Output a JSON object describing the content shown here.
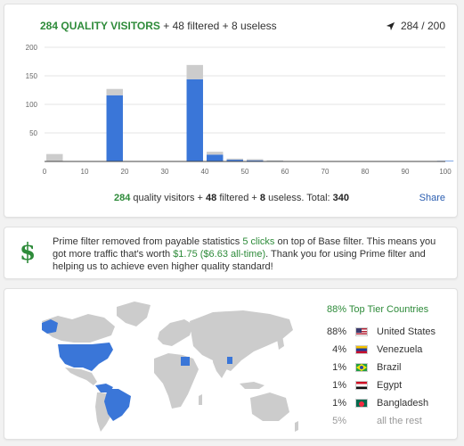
{
  "header": {
    "quality_count": "284 QUALITY VISITORS",
    "rest": " + 48 filtered + 8 useless",
    "counter": "284 / 200",
    "counter_icon": "send-arrow-icon"
  },
  "chart_data": {
    "type": "bar",
    "stacked": true,
    "x": [
      0,
      5,
      10,
      15,
      20,
      25,
      30,
      35,
      40,
      45,
      50,
      55,
      60,
      65,
      70,
      75,
      80,
      85,
      90,
      95,
      100
    ],
    "xticks": [
      0,
      10,
      20,
      30,
      40,
      50,
      60,
      70,
      80,
      90,
      100
    ],
    "yticks": [
      50,
      100,
      150,
      200
    ],
    "xlim": [
      0,
      100
    ],
    "ylim": [
      0,
      200
    ],
    "grid": "horizontal",
    "series": [
      {
        "color": "#3a76d8",
        "values": [
          0,
          0,
          0,
          116,
          0,
          0,
          0,
          144,
          12,
          3,
          2,
          1,
          0,
          0,
          0,
          0,
          0,
          0,
          0,
          0,
          1
        ]
      },
      {
        "color": "#cccccc",
        "values": [
          13,
          0,
          0,
          11,
          0,
          0,
          0,
          25,
          5,
          2,
          2,
          1,
          0,
          0,
          0,
          0,
          0,
          0,
          0,
          0,
          0
        ]
      }
    ]
  },
  "summary": {
    "q": "284",
    "t1": " quality visitors + ",
    "f": "48",
    "t2": " filtered + ",
    "u": "8",
    "t3": " useless. Total: ",
    "total": "340",
    "share": "Share"
  },
  "prime": {
    "icon": "$",
    "t1": "Prime filter removed from payable statistics ",
    "clicks": "5 clicks",
    "t2": " on top of Base filter. This means you got more traffic that's worth ",
    "worth": "$1.75 ($6.63 all-time)",
    "t3": ". Thank you for using Prime filter and helping us to achieve even higher quality standard!"
  },
  "geo": {
    "title": "88% Top Tier Countries",
    "countries": [
      {
        "pct": "88%",
        "name": "United States",
        "flag": "us-flag-icon"
      },
      {
        "pct": "4%",
        "name": "Venezuela",
        "flag": "venezuela-flag-icon"
      },
      {
        "pct": "1%",
        "name": "Brazil",
        "flag": "brazil-flag-icon"
      },
      {
        "pct": "1%",
        "name": "Egypt",
        "flag": "egypt-flag-icon"
      },
      {
        "pct": "1%",
        "name": "Bangladesh",
        "flag": "bangladesh-flag-icon"
      }
    ],
    "rest": {
      "pct": "5%",
      "name": "all the rest"
    },
    "colors": {
      "highlight": "#3a76d8",
      "land": "#cccccc"
    }
  }
}
